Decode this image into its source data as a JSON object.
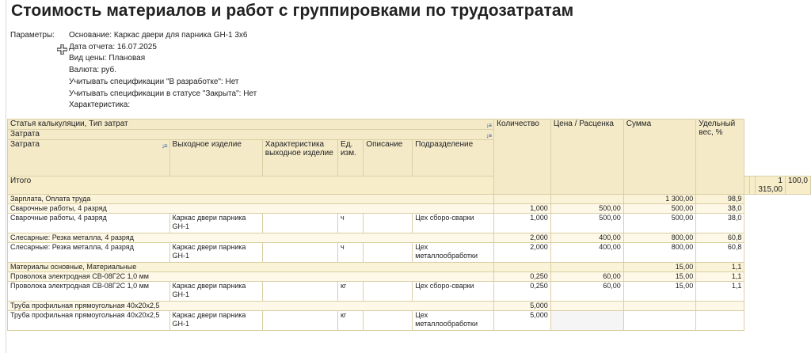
{
  "title": "Стоимость материалов и работ с группировками по трудозатратам",
  "params": {
    "label": "Параметры:",
    "lines": [
      "Основание: Каркас двери для парника GH-1 3x6",
      "Дата отчета: 16.07.2025",
      "Вид цены: Плановая",
      "Валюта: руб.",
      "Учитывать спецификации \"В разработке\": Нет",
      "Учитывать спецификации в статусе \"Закрыта\": Нет",
      "Характеристика:"
    ]
  },
  "table": {
    "header": {
      "stat": "Статья калькуляции, Тип затрат",
      "zatrata_group": "Затрата",
      "zatrata": "Затрата",
      "product": "Выходное изделие",
      "char": "Характеристика выходное изделие",
      "unit": "Ед. изм.",
      "desc": "Описание",
      "dept": "Подразделение",
      "qty": "Количество",
      "price": "Цена / Расценка",
      "sum": "Сумма",
      "share": "Удельный вес, %"
    },
    "total": {
      "label": "Итого",
      "sum": "1 315,00",
      "share": "100,0"
    },
    "rows": [
      {
        "level": 1,
        "name": "Зарплата, Оплата труда",
        "product": "",
        "unit": "",
        "dept": "",
        "qty": "",
        "price": "",
        "sum": "1 300,00",
        "share": "98,9"
      },
      {
        "level": 2,
        "name": "Сварочные работы, 4 разряд",
        "product": "",
        "unit": "",
        "dept": "",
        "qty": "1,000",
        "price": "500,00",
        "sum": "500,00",
        "share": "38,0"
      },
      {
        "level": 3,
        "name": "Сварочные работы, 4 разряд",
        "product": "Каркас двери парника GH-1",
        "unit": "ч",
        "dept": "Цех сборо-сварки",
        "qty": "1,000",
        "price": "500,00",
        "sum": "500,00",
        "share": "38,0"
      },
      {
        "level": 2,
        "name": "Слесарные: Резка металла, 4 разряд",
        "product": "",
        "unit": "",
        "dept": "",
        "qty": "2,000",
        "price": "400,00",
        "sum": "800,00",
        "share": "60,8"
      },
      {
        "level": 3,
        "name": "Слесарные: Резка металла, 4 разряд",
        "product": "Каркас двери парника GH-1",
        "unit": "ч",
        "dept": "Цех металлообработки",
        "qty": "2,000",
        "price": "400,00",
        "sum": "800,00",
        "share": "60,8"
      },
      {
        "level": 1,
        "name": "Материалы основные, Материальные",
        "product": "",
        "unit": "",
        "dept": "",
        "qty": "",
        "price": "",
        "sum": "15,00",
        "share": "1,1"
      },
      {
        "level": 2,
        "name": "Проволока электродная СВ-08Г2С 1,0 мм",
        "product": "",
        "unit": "",
        "dept": "",
        "qty": "0,250",
        "price": "60,00",
        "sum": "15,00",
        "share": "1,1"
      },
      {
        "level": 3,
        "name": "Проволока электродная СВ-08Г2С 1,0 мм",
        "product": "Каркас двери парника GH-1",
        "unit": "кг",
        "dept": "Цех сборо-сварки",
        "qty": "0,250",
        "price": "60,00",
        "sum": "15,00",
        "share": "1,1"
      },
      {
        "level": 2,
        "name": "Труба профильная прямоугольная 40х20х2,5",
        "product": "",
        "unit": "",
        "dept": "",
        "qty": "5,000",
        "price": "",
        "sum": "",
        "share": ""
      },
      {
        "level": 3,
        "name": "Труба профильная прямоугольная 40х20х2,5",
        "product": "Каркас двери парника GH-1",
        "unit": "кг",
        "dept": "Цех металлообработки",
        "qty": "5,000",
        "price": "",
        "sum": "",
        "share": "",
        "shaded": true
      }
    ]
  }
}
